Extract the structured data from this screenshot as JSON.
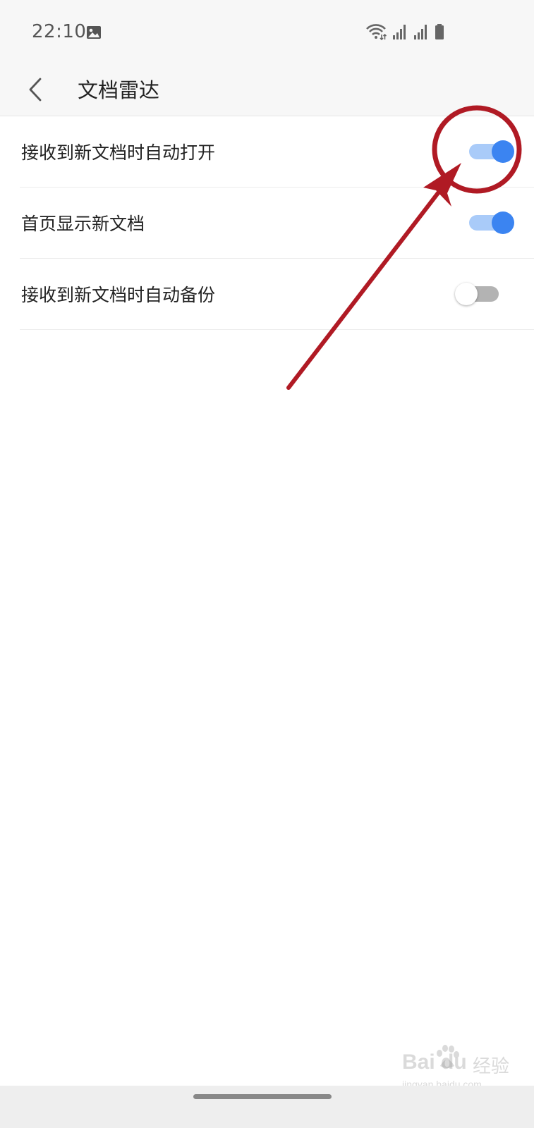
{
  "status_bar": {
    "time": "22:10",
    "icons": [
      "gallery-icon",
      "wifi-icon",
      "signal-icon",
      "signal-icon",
      "battery-icon"
    ]
  },
  "header": {
    "back_icon": "chevron-left-icon",
    "title": "文档雷达"
  },
  "settings": [
    {
      "label": "接收到新文档时自动打开",
      "enabled": true
    },
    {
      "label": "首页显示新文档",
      "enabled": true
    },
    {
      "label": "接收到新文档时自动备份",
      "enabled": false
    }
  ],
  "colors": {
    "toggle_on_knob": "#3b84f1",
    "toggle_on_track": "#a9cbf9",
    "toggle_off_track": "#b3b3b3",
    "annotation_red": "#b01a24",
    "bar_background": "#f7f7f7"
  },
  "watermark": {
    "logo": "Bai du",
    "text": "经验",
    "sub": "jingyan.baidu.com"
  }
}
